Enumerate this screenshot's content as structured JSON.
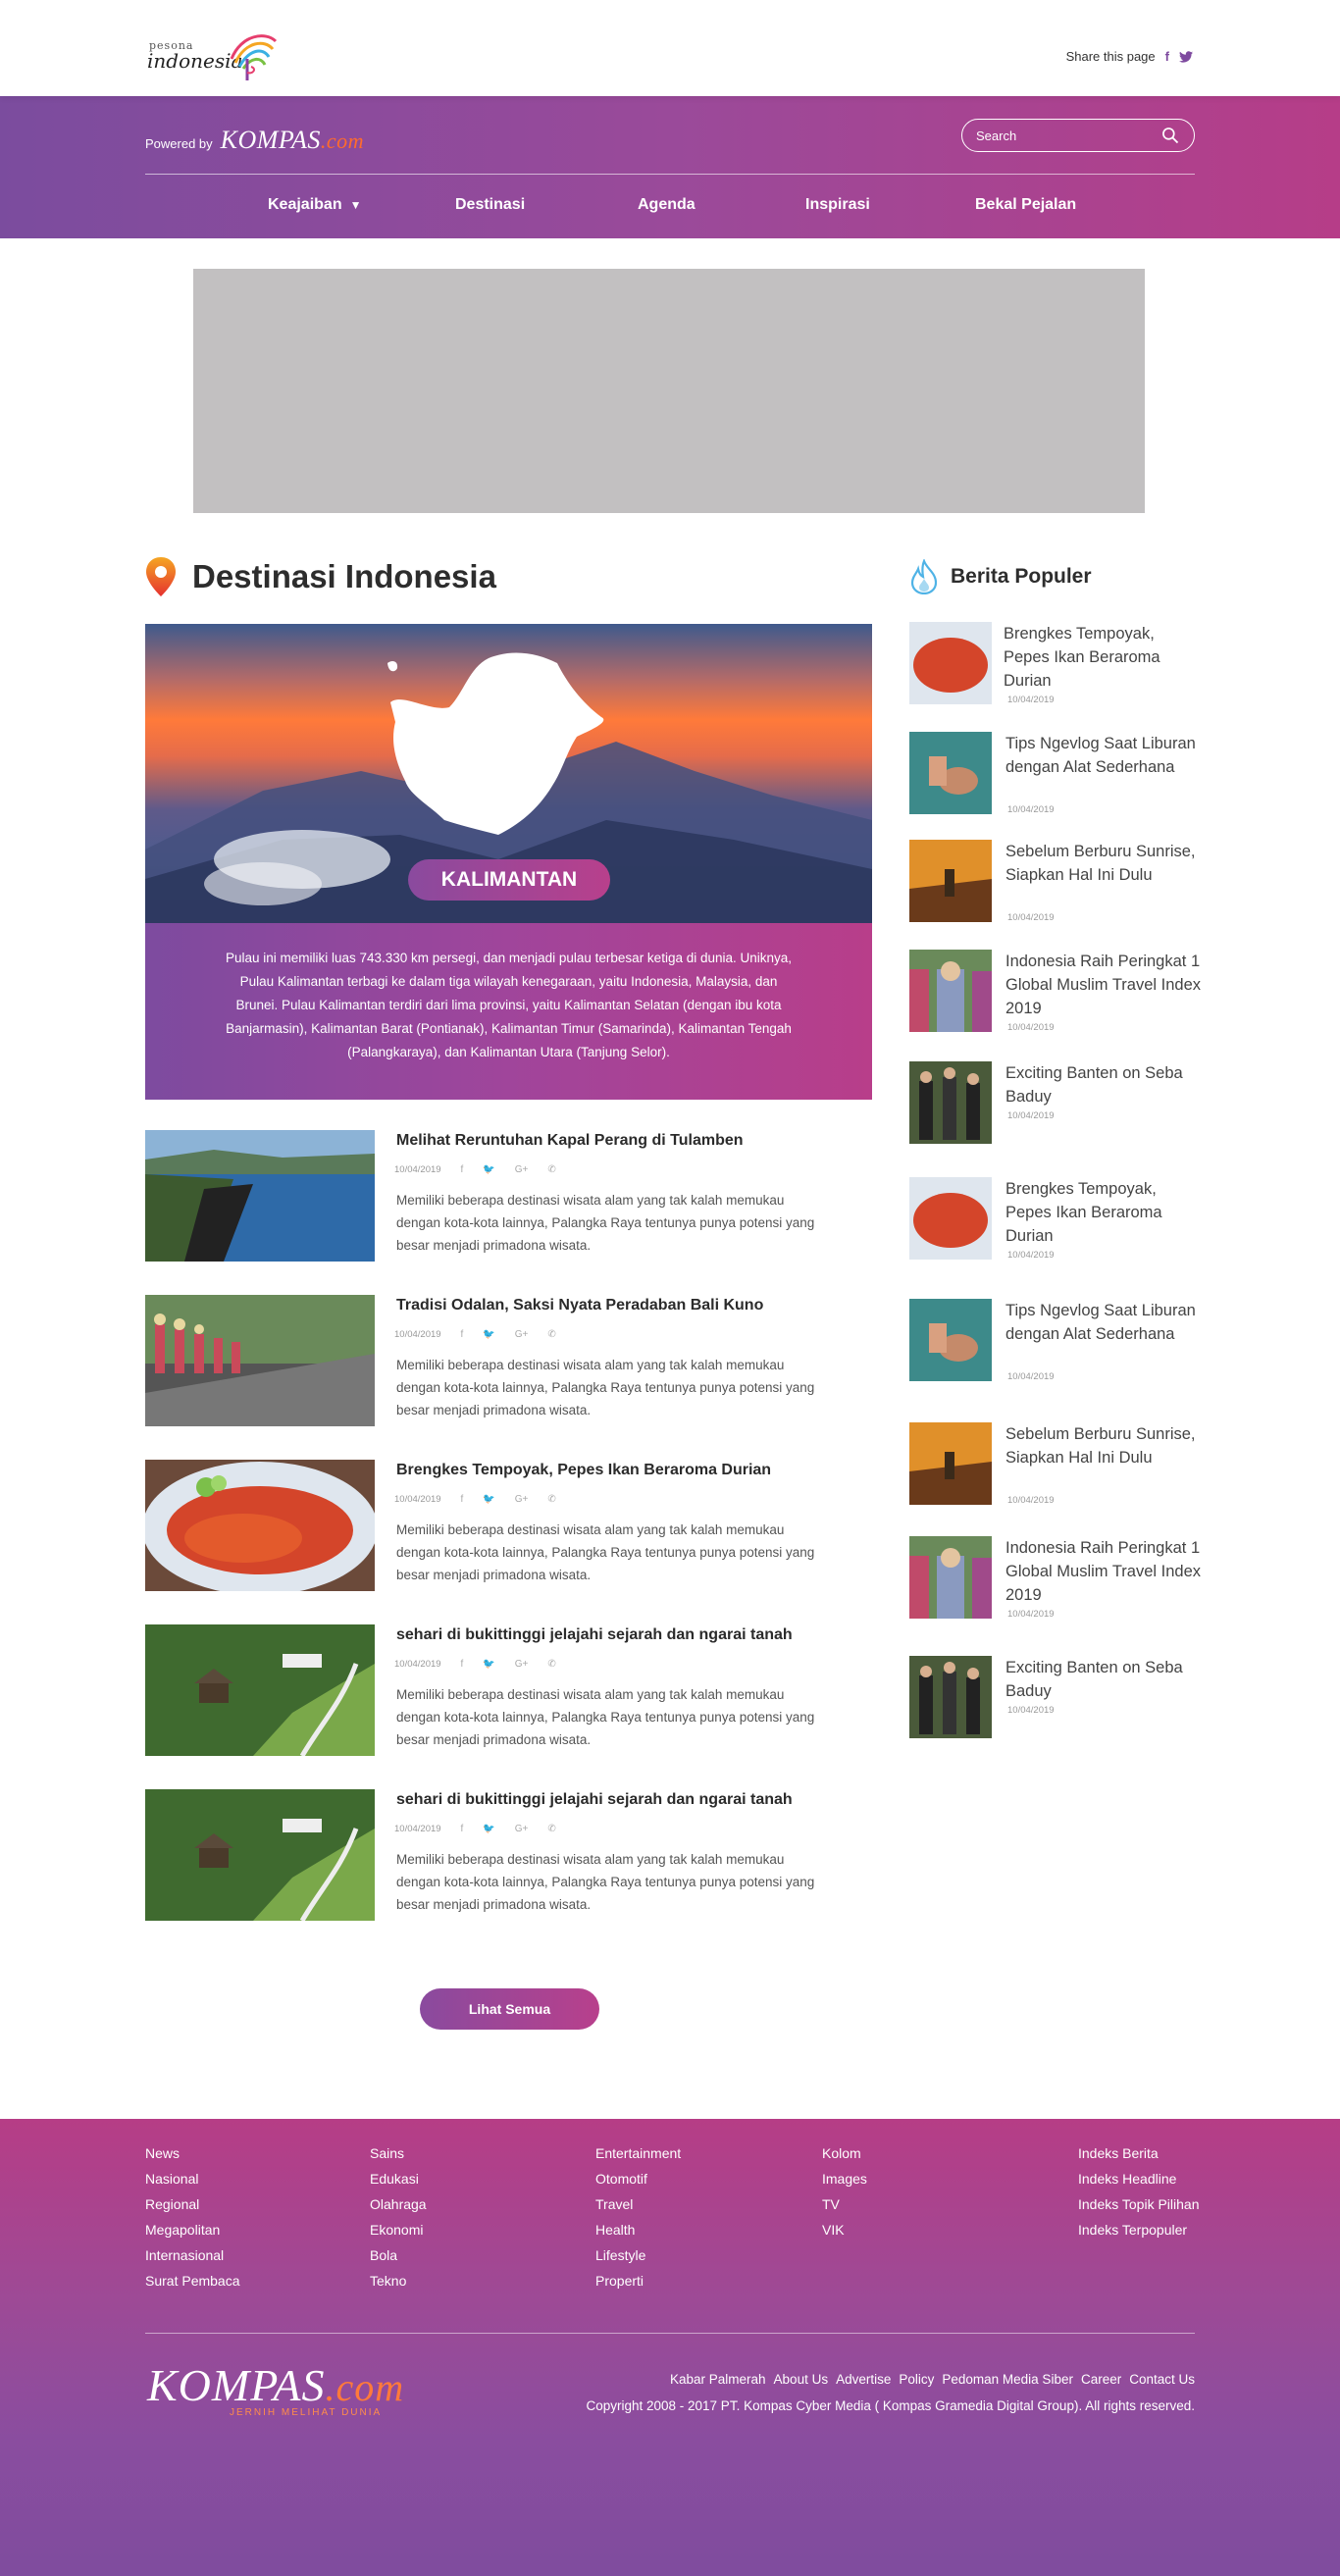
{
  "topbar": {
    "logo_small": "pesona",
    "logo_big": "indonesia",
    "share_label": "Share this page",
    "share_icons": [
      "facebook-icon",
      "twitter-icon"
    ]
  },
  "header": {
    "powered_label": "Powered by",
    "kompas_text": "KOMPAS",
    "kompas_com": ".com",
    "search_placeholder": "Search",
    "nav": [
      {
        "label": "Keajaiban",
        "has_caret": true
      },
      {
        "label": "Destinasi"
      },
      {
        "label": "Agenda"
      },
      {
        "label": "Inspirasi"
      },
      {
        "label": "Bekal Pejalan"
      }
    ]
  },
  "main": {
    "section_title": "Destinasi Indonesia",
    "hero_label": "KALIMANTAN",
    "hero_description": "Pulau ini memiliki luas 743.330 km persegi, dan menjadi pulau terbesar ketiga di dunia. Uniknya, Pulau Kalimantan terbagi ke dalam tiga wilayah kenegaraan, yaitu Indonesia, Malaysia, dan Brunei. Pulau Kalimantan terdiri dari lima provinsi, yaitu Kalimantan Selatan (dengan ibu kota Banjarmasin), Kalimantan Barat (Pontianak), Kalimantan Timur (Samarinda), Kalimantan Tengah (Palangkaraya), dan Kalimantan Utara (Tanjung Selor).",
    "articles": [
      {
        "title": "Melihat Reruntuhan Kapal Perang di Tulamben",
        "date": "10/04/2019",
        "body": "Memiliki beberapa destinasi wisata alam yang tak kalah memukau dengan kota-kota lainnya, Palangka Raya tentunya punya potensi yang besar menjadi primadona wisata."
      },
      {
        "title": "Tradisi Odalan, Saksi Nyata Peradaban Bali Kuno",
        "date": "10/04/2019",
        "body": "Memiliki beberapa destinasi wisata alam yang tak kalah memukau dengan kota-kota lainnya, Palangka Raya tentunya punya potensi yang besar menjadi primadona wisata."
      },
      {
        "title": "Brengkes Tempoyak, Pepes Ikan Beraroma Durian",
        "date": "10/04/2019",
        "body": "Memiliki beberapa destinasi wisata alam yang tak kalah memukau dengan kota-kota lainnya, Palangka Raya tentunya punya potensi yang besar menjadi primadona wisata."
      },
      {
        "title": "sehari di bukittinggi jelajahi sejarah dan ngarai tanah",
        "date": "10/04/2019",
        "body": "Memiliki beberapa destinasi wisata alam yang tak kalah memukau dengan kota-kota lainnya, Palangka Raya tentunya punya potensi yang besar menjadi primadona wisata."
      },
      {
        "title": "sehari di bukittinggi jelajahi sejarah dan ngarai tanah",
        "date": "10/04/2019",
        "body": "Memiliki beberapa destinasi wisata alam yang tak kalah memukau dengan kota-kota lainnya, Palangka Raya tentunya punya potensi yang besar menjadi primadona wisata."
      }
    ],
    "more_button": "Lihat Semua"
  },
  "popular": {
    "title": "Berita Populer",
    "items": [
      {
        "title": "Brengkes Tempoyak, Pepes Ikan Beraroma Durian",
        "date": "10/04/2019"
      },
      {
        "title": "Tips Ngevlog Saat Liburan dengan Alat Sederhana",
        "date": "10/04/2019"
      },
      {
        "title": "Sebelum Berburu Sunrise, Siapkan Hal Ini Dulu",
        "date": "10/04/2019"
      },
      {
        "title": "Indonesia Raih Peringkat 1 Global Muslim Travel Index 2019",
        "date": "10/04/2019"
      },
      {
        "title": "Exciting Banten on Seba Baduy",
        "date": "10/04/2019"
      },
      {
        "title": "Brengkes Tempoyak, Pepes Ikan Beraroma Durian",
        "date": "10/04/2019"
      },
      {
        "title": "Tips Ngevlog Saat Liburan dengan Alat Sederhana",
        "date": "10/04/2019"
      },
      {
        "title": "Sebelum Berburu Sunrise, Siapkan Hal Ini Dulu",
        "date": "10/04/2019"
      },
      {
        "title": "Indonesia Raih Peringkat 1 Global Muslim Travel Index 2019",
        "date": "10/04/2019"
      },
      {
        "title": "Exciting Banten on Seba Baduy",
        "date": "10/04/2019"
      }
    ]
  },
  "footer": {
    "columns": [
      [
        "News",
        "Nasional",
        "Regional",
        "Megapolitan",
        "Internasional",
        "Surat Pembaca"
      ],
      [
        "Sains",
        "Edukasi",
        "Olahraga",
        "Ekonomi",
        "Bola",
        "Tekno"
      ],
      [
        "Entertainment",
        "Otomotif",
        "Travel",
        "Health",
        "Lifestyle",
        "Properti"
      ],
      [
        "Kolom",
        "Images",
        "TV",
        "VIK"
      ],
      [
        "Indeks Berita",
        "Indeks Headline",
        "Indeks Topik Pilihan",
        "Indeks Terpopuler"
      ]
    ],
    "logo_text": "KOMPAS",
    "logo_com": ".com",
    "tagline": "JERNIH MELIHAT DUNIA",
    "links": [
      "Kabar Palmerah",
      "About Us",
      "Advertise",
      "Policy",
      "Pedoman Media Siber",
      "Career",
      "Contact Us"
    ],
    "copyright": "Copyright 2008 - 2017 PT. Kompas Cyber Media ( Kompas Gramedia Digital Group). All rights reserved."
  },
  "colors": {
    "primary_purple": "#7b4c9e",
    "primary_magenta": "#b63d88",
    "kompas_orange": "#ff6b2c",
    "ad_gray": "#c2c0c1"
  }
}
